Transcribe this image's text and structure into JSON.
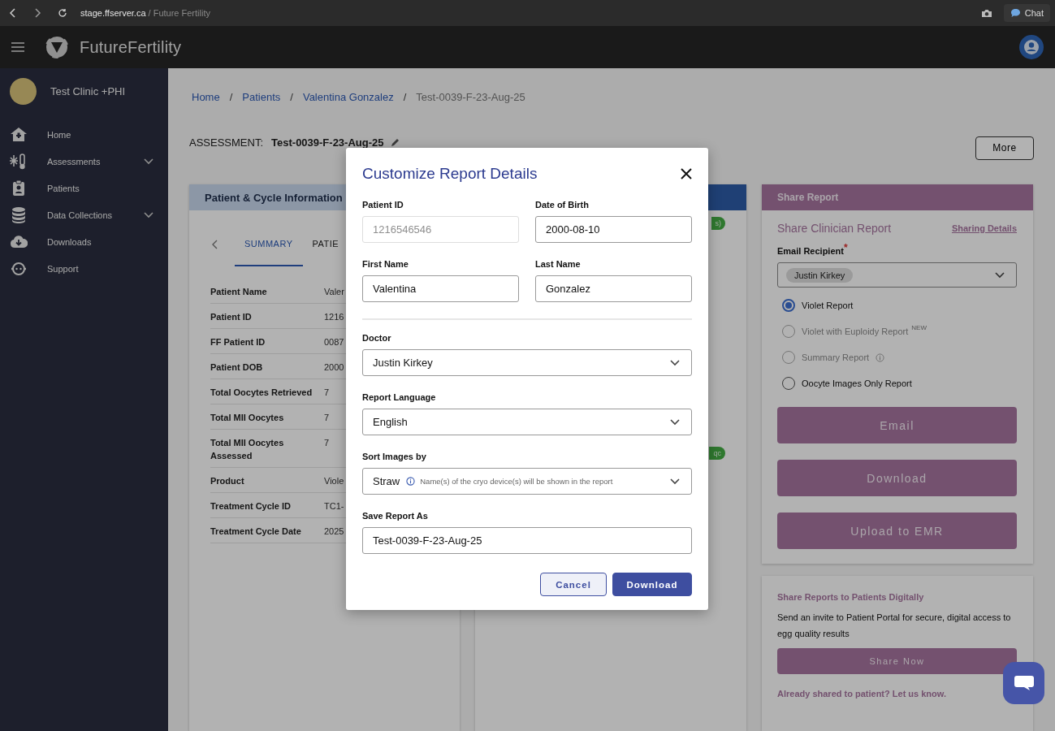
{
  "browser": {
    "host": "stage.ffserver.ca",
    "page_title": "/ Future Fertility",
    "chat_label": "Chat"
  },
  "app_header": {
    "brand": "FutureFertility"
  },
  "sidebar": {
    "clinic": "Test Clinic +PHI",
    "items": [
      {
        "label": "Home",
        "expandable": false
      },
      {
        "label": "Assessments",
        "expandable": true
      },
      {
        "label": "Patients",
        "expandable": false
      },
      {
        "label": "Data Collections",
        "expandable": true
      },
      {
        "label": "Downloads",
        "expandable": false
      },
      {
        "label": "Support",
        "expandable": false
      }
    ]
  },
  "breadcrumb": [
    {
      "label": "Home",
      "kind": "link"
    },
    {
      "label": "Patients",
      "kind": "link"
    },
    {
      "label": "Valentina Gonzalez",
      "kind": "link"
    },
    {
      "label": "Test-0039-F-23-Aug-25",
      "kind": "current"
    }
  ],
  "breadcrumb_separator": "/",
  "assessment": {
    "label": "ASSESSMENT:",
    "value": "Test-0039-F-23-Aug-25"
  },
  "more_button": "More",
  "patient_panel": {
    "title": "Patient & Cycle Information",
    "tabs": [
      {
        "label": "SUMMARY",
        "selected": true
      },
      {
        "label": "PATIE",
        "selected": false
      }
    ],
    "rows": [
      {
        "label": "Patient Name",
        "value": "Valer"
      },
      {
        "label": "Patient ID",
        "value": "1216"
      },
      {
        "label": "FF Patient ID",
        "value": "0087"
      },
      {
        "label": "Patient DOB",
        "value": "2000"
      },
      {
        "label": "Total Oocytes Retrieved",
        "value": "7"
      },
      {
        "label": "Total MII Oocytes",
        "value": "7"
      },
      {
        "label": "Total MII Oocytes Assessed",
        "value": "7"
      },
      {
        "label": "Product",
        "value": "Viole"
      },
      {
        "label": "Treatment Cycle ID",
        "value": "TC1-"
      },
      {
        "label": "Treatment Cycle Date",
        "value": "2025"
      }
    ]
  },
  "middle_panel": {
    "badges": [
      "s)",
      "qc"
    ]
  },
  "share_panel": {
    "title": "Share Report",
    "subtitle": "Share Clinician Report",
    "details_link": "Sharing Details",
    "recipient_label": "Email Recipient",
    "required_mark": "*",
    "recipient_chip": "Justin Kirkey",
    "options": [
      {
        "label": "Violet Report",
        "selected": true,
        "disabled": false
      },
      {
        "label": "Violet with Euploidy Report",
        "badge": "NEW",
        "selected": false,
        "disabled": true
      },
      {
        "label": "Summary Report",
        "info": true,
        "selected": false,
        "disabled": true
      },
      {
        "label": "Oocyte Images Only Report",
        "selected": false,
        "disabled": false
      }
    ],
    "buttons": [
      "Email",
      "Download",
      "Upload to EMR"
    ]
  },
  "patient_share_card": {
    "title": "Share Reports to Patients Digitally",
    "text": "Send an invite to Patient Portal for secure, digital access to egg quality results",
    "button": "Share Now",
    "link": "Already shared to patient? Let us know."
  },
  "modal": {
    "title": "Customize Report Details",
    "identity_fields": [
      {
        "label": "Patient ID",
        "value": "1216546546",
        "disabled": true
      },
      {
        "label": "Date of Birth",
        "value": "2000-08-10",
        "disabled": false
      },
      {
        "label": "First Name",
        "value": "Valentina",
        "disabled": false
      },
      {
        "label": "Last Name",
        "value": "Gonzalez",
        "disabled": false
      }
    ],
    "report_fields": [
      {
        "label": "Doctor",
        "kind": "select",
        "value": "Justin Kirkey"
      },
      {
        "label": "Report Language",
        "kind": "select",
        "value": "English"
      },
      {
        "label": "Sort Images by",
        "kind": "select",
        "value": "Straw",
        "hint": "Name(s) of the cryo device(s) will be shown in the report"
      },
      {
        "label": "Save Report As",
        "kind": "input",
        "value": "Test-0039-F-23-Aug-25"
      }
    ],
    "buttons": [
      {
        "label": "Cancel",
        "kind": "secondary"
      },
      {
        "label": "Download",
        "kind": "primary"
      }
    ]
  }
}
